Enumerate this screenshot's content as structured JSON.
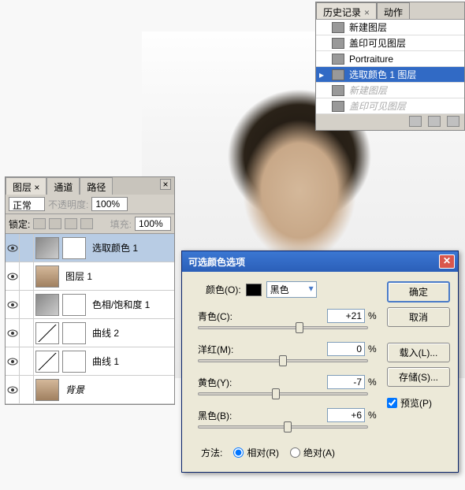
{
  "history": {
    "tabs": {
      "history": "历史记录",
      "actions": "动作"
    },
    "items": [
      {
        "label": "新建图层"
      },
      {
        "label": "盖印可见图层"
      },
      {
        "label": "Portraiture"
      },
      {
        "label": "选取颜色 1 图层",
        "selected": true
      },
      {
        "label": "新建图层",
        "dim": true
      },
      {
        "label": "盖印可见图层",
        "dim": true
      }
    ]
  },
  "layers": {
    "tabs": {
      "layers": "图层",
      "channels": "通道",
      "paths": "路径"
    },
    "blend": "正常",
    "opacity_label": "不透明度:",
    "opacity": "100%",
    "lock_label": "锁定:",
    "fill_label": "填充:",
    "fill": "100%",
    "items": [
      {
        "name": "选取颜色 1",
        "selected": true,
        "kind": "adj",
        "mask": true
      },
      {
        "name": "图层 1",
        "kind": "photo"
      },
      {
        "name": "色相/饱和度 1",
        "kind": "adj",
        "mask": true
      },
      {
        "name": "曲线 2",
        "kind": "curve",
        "mask": true
      },
      {
        "name": "曲线 1",
        "kind": "curve",
        "mask": true
      },
      {
        "name": "背景",
        "kind": "photo",
        "italic": true
      }
    ]
  },
  "dialog": {
    "title": "可选颜色选项",
    "color_label": "颜色(O):",
    "color_value": "黑色",
    "sliders": {
      "cyan": {
        "label": "青色(C):",
        "value": "+21",
        "pos": 60
      },
      "magenta": {
        "label": "洋红(M):",
        "value": "0",
        "pos": 50
      },
      "yellow": {
        "label": "黄色(Y):",
        "value": "-7",
        "pos": 46
      },
      "black": {
        "label": "黑色(B):",
        "value": "+6",
        "pos": 53
      }
    },
    "method_label": "方法:",
    "method": {
      "relative": "相对(R)",
      "absolute": "绝对(A)"
    },
    "buttons": {
      "ok": "确定",
      "cancel": "取消",
      "load": "载入(L)...",
      "save": "存储(S)..."
    },
    "preview": "预览(P)"
  }
}
